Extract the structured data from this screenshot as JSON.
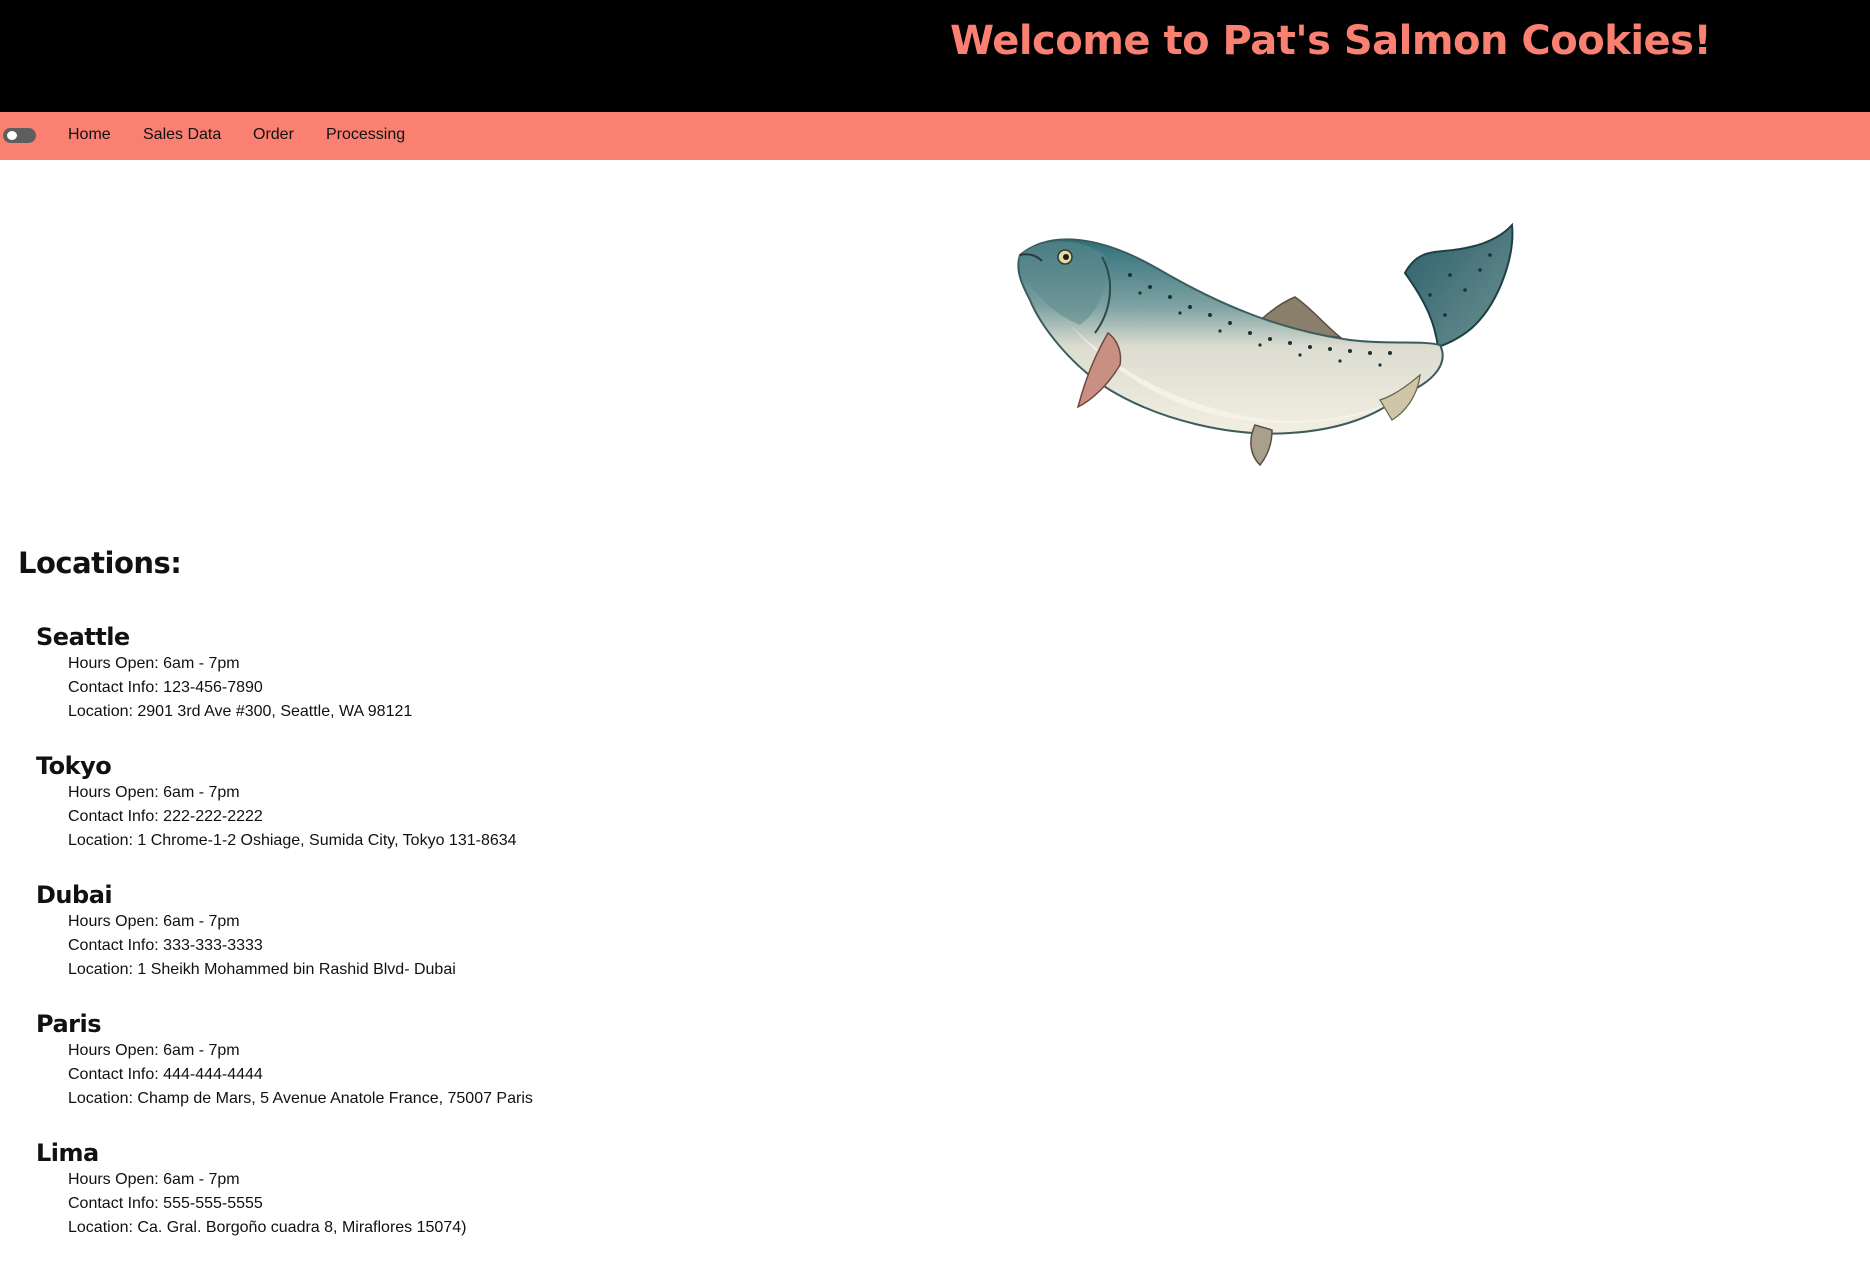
{
  "header": {
    "title": "Welcome to Pat's Salmon Cookies!"
  },
  "nav": {
    "toggle": "theme-toggle",
    "items": [
      {
        "label": "Home"
      },
      {
        "label": "Sales Data"
      },
      {
        "label": "Order"
      },
      {
        "label": "Processing"
      }
    ]
  },
  "hero": {
    "image": "salmon-fish-illustration"
  },
  "locations": {
    "heading": "Locations:",
    "stores": [
      {
        "name": "Seattle",
        "hours": "Hours Open: 6am - 7pm",
        "contact": "Contact Info: 123-456-7890",
        "location": "Location: 2901 3rd Ave #300, Seattle, WA 98121"
      },
      {
        "name": "Tokyo",
        "hours": "Hours Open: 6am - 7pm",
        "contact": "Contact Info: 222-222-2222",
        "location": "Location: 1 Chrome-1-2 Oshiage, Sumida City, Tokyo 131-8634"
      },
      {
        "name": "Dubai",
        "hours": "Hours Open: 6am - 7pm",
        "contact": "Contact Info: 333-333-3333",
        "location": "Location: 1 Sheikh Mohammed bin Rashid Blvd- Dubai"
      },
      {
        "name": "Paris",
        "hours": "Hours Open: 6am - 7pm",
        "contact": "Contact Info: 444-444-4444",
        "location": "Location: Champ de Mars, 5 Avenue Anatole France, 75007 Paris"
      },
      {
        "name": "Lima",
        "hours": "Hours Open: 6am - 7pm",
        "contact": "Contact Info: 555-555-5555",
        "location": "Location: Ca. Gral. Borgoño cuadra 8, Miraflores 15074)"
      }
    ]
  },
  "colors": {
    "header_bg": "#000000",
    "accent": "#fa8072",
    "text": "#111111",
    "toggle": "#5e5e5e"
  }
}
